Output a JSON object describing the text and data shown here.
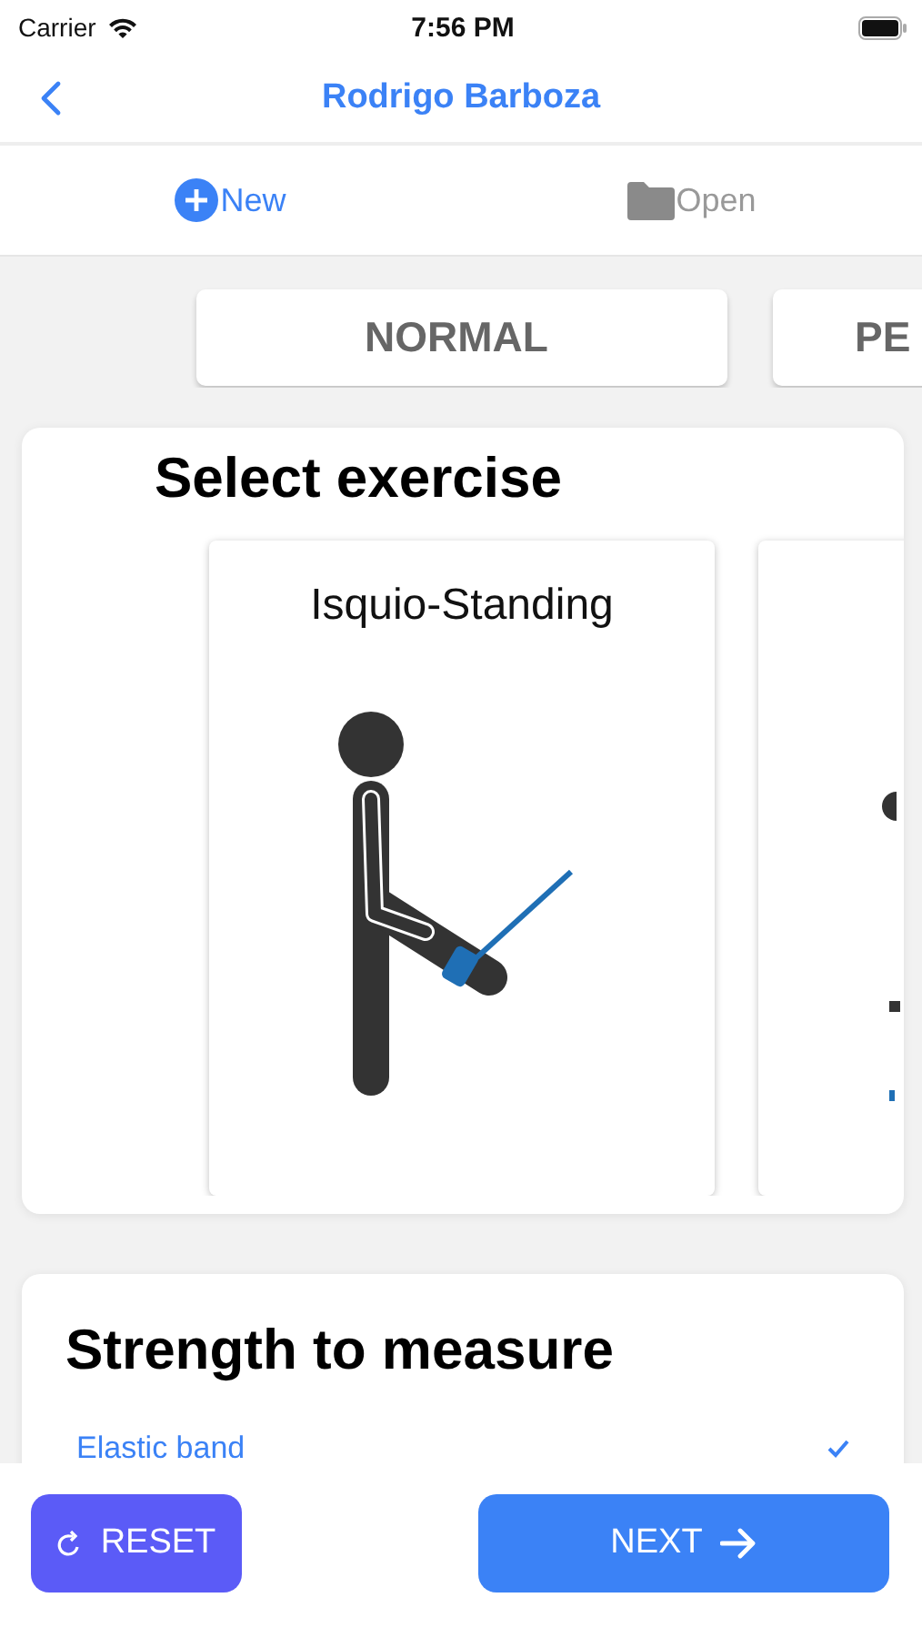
{
  "status_bar": {
    "carrier": "Carrier",
    "time": "7:56 PM"
  },
  "nav": {
    "title": "Rodrigo Barboza"
  },
  "toolbar": [
    {
      "kind": "new",
      "label": "New",
      "selected": true
    },
    {
      "kind": "open",
      "label": "Open",
      "selected": false
    }
  ],
  "modes": [
    {
      "label": "NORMAL"
    },
    {
      "label": "PE"
    }
  ],
  "exercise_section": {
    "title": "Select exercise",
    "cards": [
      {
        "title": "Isquio-Standing",
        "kind": "standing"
      },
      {
        "kind": "partial"
      }
    ]
  },
  "strength_section": {
    "title": "Strength to measure",
    "options": [
      {
        "label": "Elastic band",
        "selected": true
      }
    ]
  },
  "buttons": [
    {
      "kind": "reset",
      "label": "RESET"
    },
    {
      "kind": "next",
      "label": "NEXT"
    }
  ]
}
